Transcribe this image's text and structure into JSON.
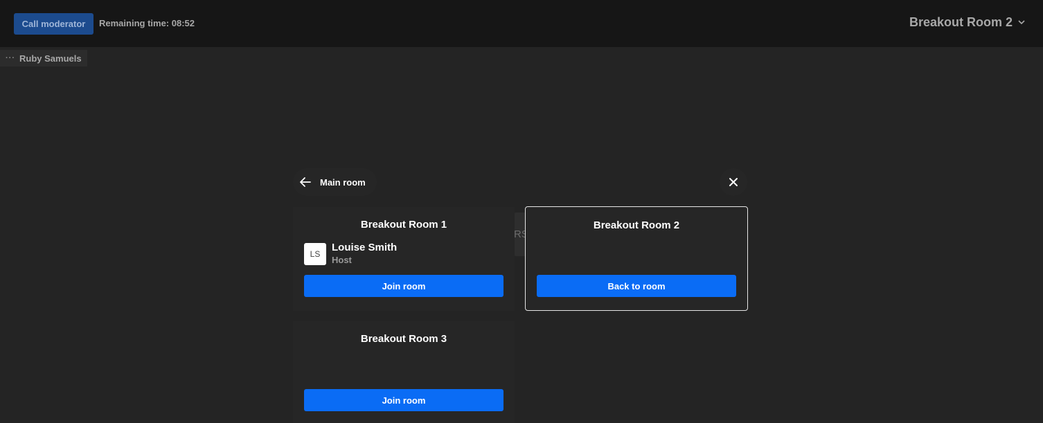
{
  "header": {
    "call_moderator_label": "Call moderator",
    "remaining_time": "Remaining time: 08:52",
    "current_room": "Breakout Room 2"
  },
  "participant_tag": {
    "menu_dots": "···",
    "name": "Ruby Samuels"
  },
  "panel": {
    "back_label": "Main room",
    "ghost_label": "RS",
    "rooms": [
      {
        "title": "Breakout Room 1",
        "members": [
          {
            "initials": "LS",
            "name": "Louise Smith",
            "role": "Host"
          }
        ],
        "button_label": "Join room",
        "active": false
      },
      {
        "title": "Breakout Room 2",
        "members": [],
        "button_label": "Back to room",
        "active": true
      },
      {
        "title": "Breakout Room 3",
        "members": [],
        "button_label": "Join room",
        "active": false
      }
    ]
  },
  "colors": {
    "background": "#242424",
    "topbar": "#161616",
    "accent": "#0a6cf5",
    "moderator_button": "#1c4b8e"
  },
  "icons": {
    "back": "arrow-left-icon",
    "close": "close-icon",
    "room_switcher": "chevron-down-icon",
    "participant_menu": "more-dots-icon"
  }
}
